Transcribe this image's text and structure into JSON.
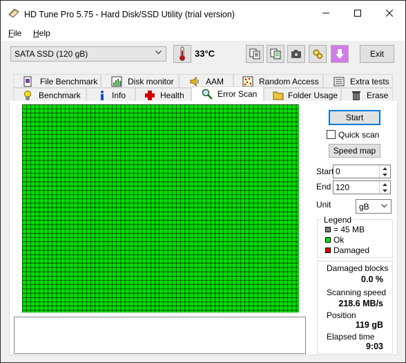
{
  "window": {
    "title": "HD Tune Pro 5.75 - Hard Disk/SSD Utility (trial version)"
  },
  "menu": {
    "file": {
      "first": "F",
      "rest": "ile"
    },
    "help": {
      "first": "H",
      "rest": "elp"
    }
  },
  "toolbar": {
    "drive": "SATA SSD (120 gB)",
    "temperature": "33°C",
    "exit_label": "Exit",
    "icons": [
      "copy-text-icon",
      "copy-all-icon",
      "screenshot-icon",
      "options-icon",
      "save-icon"
    ]
  },
  "tabs": {
    "row1": [
      {
        "label": "File Benchmark",
        "icon": "file-benchmark-icon"
      },
      {
        "label": "Disk monitor",
        "icon": "disk-monitor-icon"
      },
      {
        "label": "AAM",
        "icon": "speaker-icon"
      },
      {
        "label": "Random Access",
        "icon": "random-access-icon"
      },
      {
        "label": "Extra tests",
        "icon": "extra-tests-icon"
      }
    ],
    "row2": [
      {
        "label": "Benchmark",
        "icon": "lightbulb-icon"
      },
      {
        "label": "Info",
        "icon": "info-icon"
      },
      {
        "label": "Health",
        "icon": "health-cross-icon"
      },
      {
        "label": "Error Scan",
        "icon": "magnifier-icon"
      },
      {
        "label": "Folder Usage",
        "icon": "folder-icon"
      },
      {
        "label": "Erase",
        "icon": "trash-icon"
      }
    ],
    "active": "Error Scan"
  },
  "scan": {
    "start_label": "Start",
    "quick_scan_label": "Quick scan",
    "quick_scan_checked": false,
    "speed_map_label": "Speed map",
    "start_field_label": "Start",
    "start_value": "0",
    "end_field_label": "End",
    "end_value": "120",
    "unit_label": "Unit",
    "unit_value": "gB"
  },
  "legend": {
    "title": "Legend",
    "items": [
      {
        "label": "= 45 MB",
        "color": "#808080"
      },
      {
        "label": "Ok",
        "color": "#00e000"
      },
      {
        "label": "Damaged",
        "color": "#e00000"
      }
    ]
  },
  "stats": {
    "damaged_label": "Damaged blocks",
    "damaged_value": "0.0 %",
    "speed_label": "Scanning speed",
    "speed_value": "218.6 MB/s",
    "position_label": "Position",
    "position_value": "119 gB",
    "elapsed_label": "Elapsed time",
    "elapsed_value": "9:03"
  },
  "colors": {
    "ok_block": "#00e000",
    "grid_line": "#000000",
    "accent": "#0078d7"
  }
}
